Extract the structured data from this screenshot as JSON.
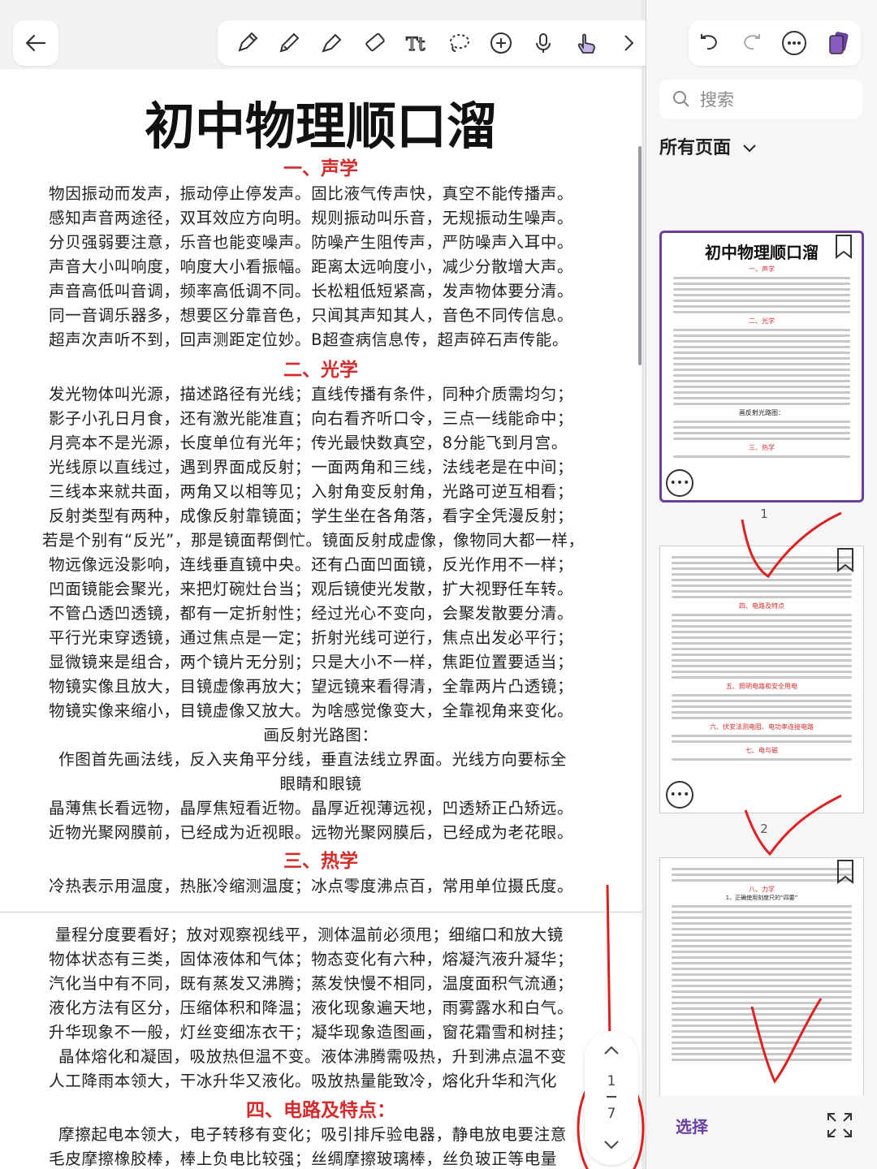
{
  "doc": {
    "title": "初中物理顺口溜",
    "sections": [
      {
        "heading": "一、声学",
        "lines": [
          "物因振动而发声，振动停止停发声。固比液气传声快，真空不能传播声。",
          "感知声音两途径，双耳效应方向明。规则振动叫乐音，无规振动生噪声。",
          "分贝强弱要注意，乐音也能变噪声。防噪产生阻传声，严防噪声入耳中。",
          "声音大小叫响度，响度大小看振幅。距离太远响度小，减少分散增大声。",
          "声音高低叫音调，频率高低调不同。长松粗低短紧高，发声物体要分清。",
          "同一音调乐器多，想要区分靠音色，只闻其声知其人，音色不同传信息。",
          "超声次声听不到，回声测距定位妙。B超查病信息传，超声碎石声传能。"
        ]
      },
      {
        "heading": "二、光学",
        "lines": [
          "发光物体叫光源，描述路径有光线；直线传播有条件，同种介质需均匀；",
          "影子小孔日月食，还有激光能准直；向右看齐听口令，三点一线能命中；",
          "月亮本不是光源，长度单位有光年；传光最快数真空，8分能飞到月宫。",
          "光线原以直线过，遇到界面成反射；一面两角和三线，法线老是在中间；",
          "三线本来就共面，两角又以相等见；入射角变反射角，光路可逆互相看；",
          "反射类型有两种，成像反射靠镜面；学生坐在各角落，看字全凭漫反射；",
          "若是个别有“反光”，那是镜面帮倒忙。镜面反射成虚像，像物同大都一样，",
          "物远像远没影响，连线垂直镜中央。还有凸面凹面镜，反光作用不一样；",
          "凹面镜能会聚光，来把灯碗灶台当；观后镜使光发散，扩大视野任车转。",
          "不管凸透凹透镜，都有一定折射性；经过光心不变向，会聚发散要分清。",
          "平行光束穿透镜，通过焦点是一定；折射光线可逆行，焦点出发必平行；",
          "显微镜来是组合，两个镜片无分别；只是大小不一样，焦距位置要适当；",
          "物镜实像且放大，目镜虚像再放大；望远镜来看得清，全靠两片凸透镜；",
          "物镜实像来缩小，目镜虚像又放大。为啥感觉像变大，全靠视角来变化。"
        ]
      },
      {
        "sub": "画反射光路图：",
        "lines": [
          "作图首先画法线，反入夹角平分线，垂直法线立界面。光线方向要标全",
          "眼睛和眼镜",
          "晶薄焦长看远物，晶厚焦短看近物。晶厚近视薄远视，凹透矫正凸矫远。",
          "近物光聚网膜前，已经成为近视眼。远物光聚网膜后，已经成为老花眼。"
        ]
      },
      {
        "heading": "三、热学",
        "lines": [
          "冷热表示用温度，热胀冷缩测温度；冰点零度沸点百，常用单位摄氏度。",
          "量程分度要看好；放对观察视线平，测体温前必须甩；细缩口和放大镜",
          "物体状态有三类，固体液体和气体；物态变化有六种，熔凝汽液升凝华；",
          "汽化当中有不同，既有蒸发又沸腾；蒸发快慢不相同，温度面积气流通；",
          "液化方法有区分，压缩体积和降温；液化现象遍天地，雨雾露水和白气。",
          "升华现象不一般，灯丝变细冻衣干；凝华现象造图画，窗花霜雪和树挂；",
          "晶体熔化和凝固，吸放热但温不变。液体沸腾需吸热，升到沸点温不变",
          "人工降雨本领大，干冰升华又液化。吸放热量能致冷，熔化升华和汽化"
        ]
      },
      {
        "heading": "四、电路及特点：",
        "lines": [
          "摩擦起电本领大，电子转移有变化；吸引排斥验电器，静电放电要注意",
          "毛皮摩擦橡胶棒，棒上负电比较强；丝绸摩擦玻璃棒，丝负玻正等电量"
        ]
      }
    ]
  },
  "sidebar": {
    "search_placeholder": "搜索",
    "pages_label": "所有页面",
    "thumbs": [
      {
        "num": "1",
        "title": "初中物理顺口溜",
        "h1": "一、声学",
        "h2": "二、光学",
        "h3": "三、热学",
        "caption": "画反射光路图："
      },
      {
        "num": "2",
        "h1": "四、电路及特点",
        "h2": "五、照明电路和安全用电",
        "h3": "六、伏安法测电阻、电功率连接电路",
        "h4": "七、电与磁"
      },
      {
        "h1": "八、力学",
        "caption": "1、正确使用刻度尺的“四要”"
      }
    ],
    "select_label": "选择"
  },
  "pager": {
    "current": "1",
    "total": "7"
  },
  "colors": {
    "accent": "#6b3fa0",
    "heading_red": "#d62a2a",
    "annotation": "#e02020"
  }
}
